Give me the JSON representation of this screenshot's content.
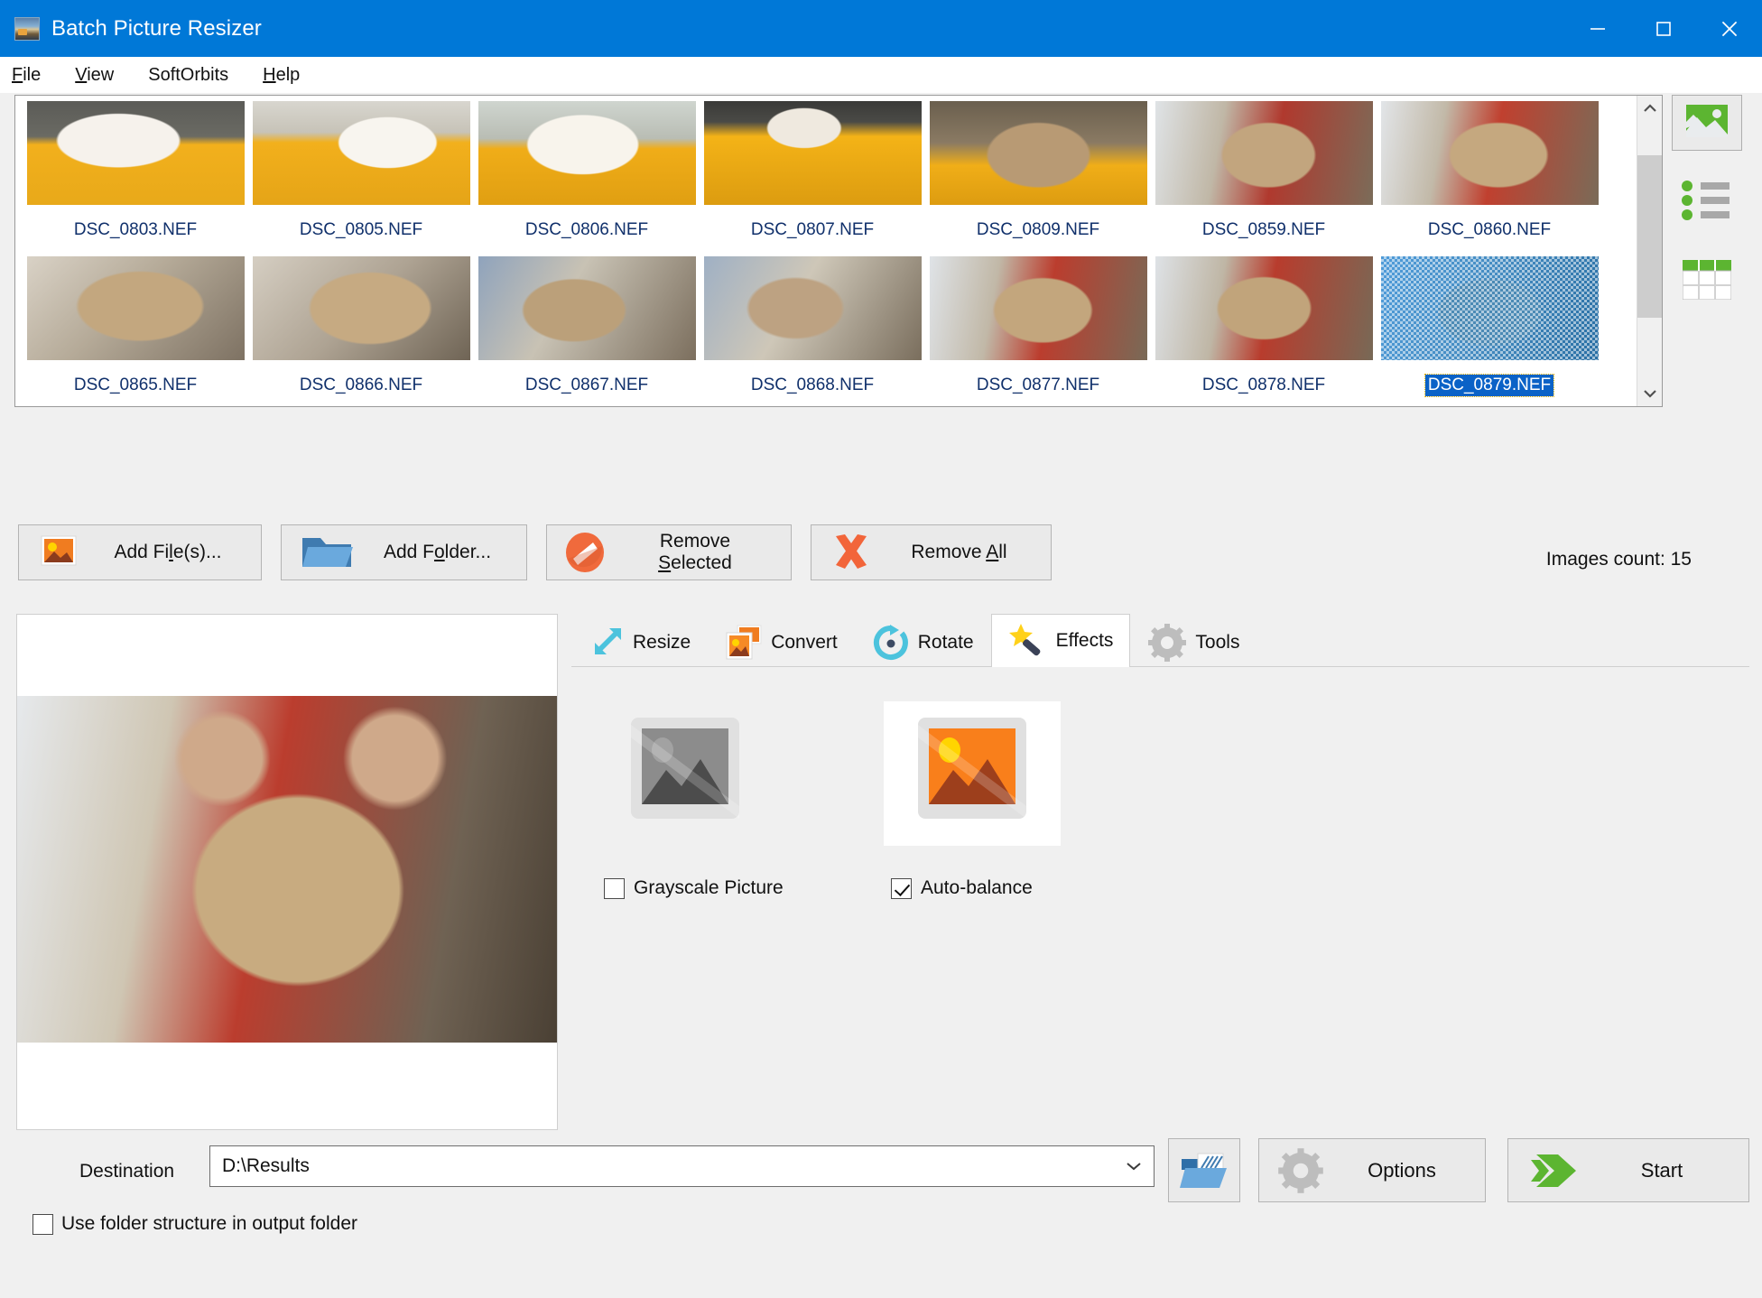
{
  "window": {
    "title": "Batch Picture Resizer",
    "icon": "app-photo-icon",
    "controls": {
      "minimize": "–",
      "maximize": "□",
      "close": "✕"
    }
  },
  "menubar": {
    "items": [
      {
        "label": "File",
        "accel": "F"
      },
      {
        "label": "View",
        "accel": "V"
      },
      {
        "label": "SoftOrbits",
        "accel": ""
      },
      {
        "label": "Help",
        "accel": "H"
      }
    ]
  },
  "thumbnails": {
    "items": [
      {
        "name": "DSC_0803.NEF",
        "selected": false
      },
      {
        "name": "DSC_0805.NEF",
        "selected": false
      },
      {
        "name": "DSC_0806.NEF",
        "selected": false
      },
      {
        "name": "DSC_0807.NEF",
        "selected": false
      },
      {
        "name": "DSC_0809.NEF",
        "selected": false
      },
      {
        "name": "DSC_0859.NEF",
        "selected": false
      },
      {
        "name": "DSC_0860.NEF",
        "selected": false
      },
      {
        "name": "DSC_0865.NEF",
        "selected": false
      },
      {
        "name": "DSC_0866.NEF",
        "selected": false
      },
      {
        "name": "DSC_0867.NEF",
        "selected": false
      },
      {
        "name": "DSC_0868.NEF",
        "selected": false
      },
      {
        "name": "DSC_0877.NEF",
        "selected": false
      },
      {
        "name": "DSC_0878.NEF",
        "selected": false
      },
      {
        "name": "DSC_0879.NEF",
        "selected": true
      }
    ]
  },
  "view_modes": [
    {
      "name": "thumbnail-view",
      "active": true
    },
    {
      "name": "list-view",
      "active": false
    },
    {
      "name": "details-view",
      "active": false
    }
  ],
  "actions": {
    "add_files": {
      "label_pre": "Add Fi",
      "accel": "l",
      "label_post": "e(s)...",
      "icon": "add-image-icon"
    },
    "add_folder": {
      "label_pre": "Add F",
      "accel": "o",
      "label_post": "lder...",
      "icon": "folder-icon"
    },
    "remove_selected": {
      "label_pre": "Remove ",
      "accel": "S",
      "label_post": "elected",
      "icon": "no-entry-icon"
    },
    "remove_all": {
      "label_pre": "Remove ",
      "accel": "A",
      "label_post": "ll",
      "icon": "red-x-icon"
    },
    "images_count": "Images count: 15"
  },
  "tabs": [
    {
      "label": "Resize",
      "icon": "resize-arrows-icon",
      "active": false
    },
    {
      "label": "Convert",
      "icon": "convert-icon",
      "active": false
    },
    {
      "label": "Rotate",
      "icon": "rotate-icon",
      "active": false
    },
    {
      "label": "Effects",
      "icon": "magic-wand-icon",
      "active": true
    },
    {
      "label": "Tools",
      "icon": "gear-icon",
      "active": false
    }
  ],
  "effects": {
    "items": [
      {
        "label": "Grayscale Picture",
        "checked": false,
        "icon": "grayscale-photo-icon",
        "selected": false
      },
      {
        "label": "Auto-balance",
        "checked": true,
        "icon": "color-photo-icon",
        "selected": true
      }
    ]
  },
  "bottom": {
    "destination_label": "Destination",
    "destination_value": "D:\\Results",
    "destination_placeholder": "D:\\Results",
    "use_folder_structure": {
      "label": "Use folder structure in output folder",
      "checked": false
    },
    "browse": {
      "label": "",
      "icon": "open-folder-icon"
    },
    "options": {
      "label": "Options",
      "icon": "gear-icon"
    },
    "start": {
      "label": "Start",
      "icon": "green-arrow-icon"
    }
  },
  "colors": {
    "title_bar": "#0078d7",
    "accent_green": "#5cb531",
    "accent_orange": "#f07c20",
    "selection_blue": "#0a62c7",
    "filename_text": "#10306b",
    "panel_bg": "#f0f0f0"
  }
}
